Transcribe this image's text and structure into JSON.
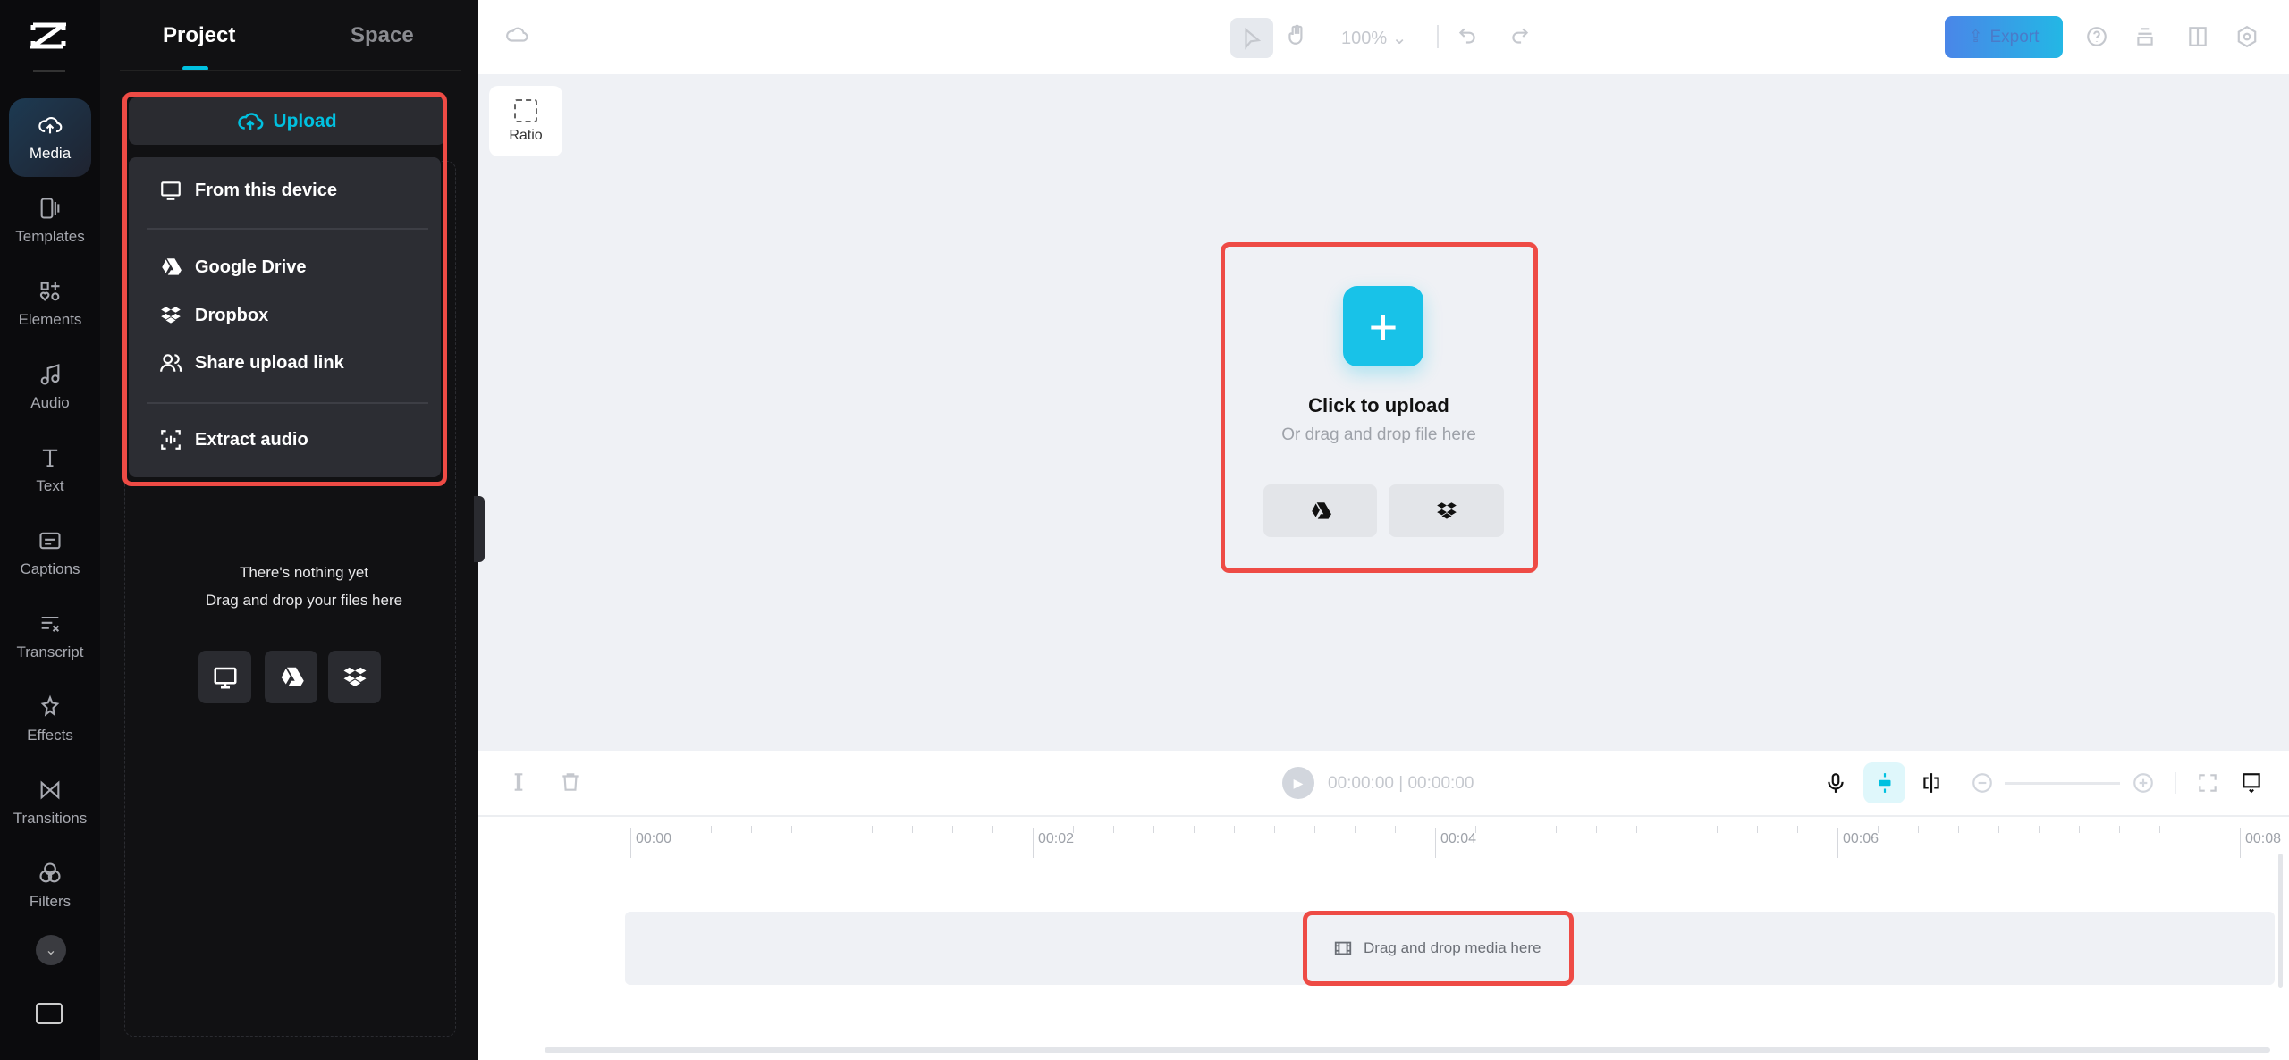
{
  "rail": {
    "items": [
      {
        "label": "Media",
        "icon": "cloud-upload-icon",
        "active": true
      },
      {
        "label": "Templates",
        "icon": "templates-icon"
      },
      {
        "label": "Elements",
        "icon": "elements-icon"
      },
      {
        "label": "Audio",
        "icon": "music-note-icon"
      },
      {
        "label": "Text",
        "icon": "text-icon"
      },
      {
        "label": "Captions",
        "icon": "captions-icon"
      },
      {
        "label": "Transcript",
        "icon": "transcript-icon"
      },
      {
        "label": "Effects",
        "icon": "effects-icon"
      },
      {
        "label": "Transitions",
        "icon": "transitions-icon"
      },
      {
        "label": "Filters",
        "icon": "filters-icon"
      }
    ]
  },
  "panel": {
    "tabs": [
      {
        "label": "Project",
        "active": true
      },
      {
        "label": "Space"
      }
    ],
    "upload_label": "Upload",
    "menu": [
      "From this device",
      "Google Drive",
      "Dropbox",
      "Share upload link",
      "Extract audio"
    ],
    "empty_title": "There's nothing yet",
    "empty_subtitle": "Drag and drop your files here"
  },
  "topbar": {
    "zoom": "100%",
    "export_label": "Export"
  },
  "canvas": {
    "ratio_label": "Ratio",
    "upload_title": "Click to upload",
    "upload_subtitle": "Or drag and drop file here"
  },
  "timeline": {
    "current_time": "00:00:00",
    "total_time": "00:00:00",
    "ruler": [
      "00:00",
      "00:02",
      "00:04",
      "00:06",
      "00:08"
    ],
    "track_hint": "Drag and drop media here"
  },
  "colors": {
    "accent": "#00c1e0",
    "highlight": "#ee4b45",
    "export_start": "#4a86e8",
    "export_end": "#23b7e5"
  }
}
